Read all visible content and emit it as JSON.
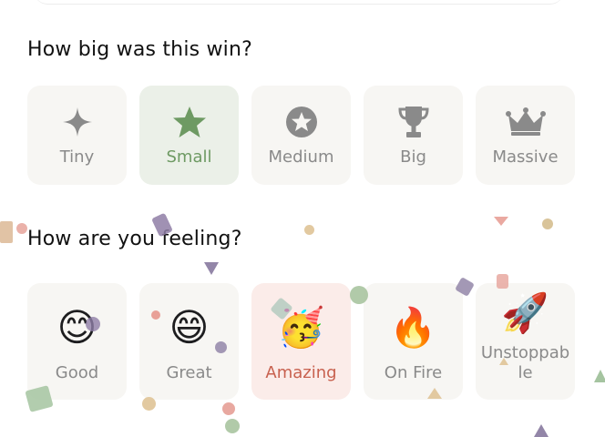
{
  "size_section": {
    "title": "How big was this win?",
    "options": [
      {
        "label": "Tiny",
        "icon": "sparkle-icon"
      },
      {
        "label": "Small",
        "icon": "star-icon",
        "selected": true
      },
      {
        "label": "Medium",
        "icon": "star-badge-icon"
      },
      {
        "label": "Big",
        "icon": "trophy-icon"
      },
      {
        "label": "Massive",
        "icon": "crown-icon"
      }
    ]
  },
  "feeling_section": {
    "title": "How are you feeling?",
    "options": [
      {
        "label": "Good",
        "emoji": "😊"
      },
      {
        "label": "Great",
        "emoji": "😄"
      },
      {
        "label": "Amazing",
        "emoji": "🥳",
        "selected": true
      },
      {
        "label": "On Fire",
        "emoji": "🔥"
      },
      {
        "label": "Unstoppable",
        "emoji": "🚀"
      }
    ]
  },
  "colors": {
    "selected_green": "#6e9a63",
    "selected_pink": "#c8614f",
    "tile_bg": "#f7f6f3",
    "icon_gray": "#8a8a8a"
  }
}
